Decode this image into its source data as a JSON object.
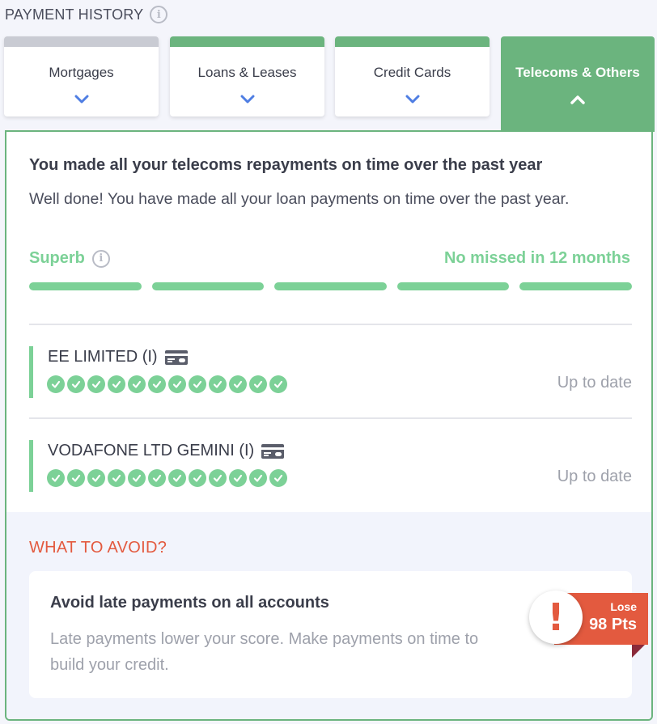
{
  "header": {
    "title": "PAYMENT HISTORY",
    "info_icon": "info-icon"
  },
  "tabs": [
    {
      "label": "Mortgages",
      "bar_color": "#c9cbd3",
      "icon": "chevron-down-icon"
    },
    {
      "label": "Loans & Leases",
      "bar_color": "#6bb47e",
      "icon": "chevron-down-icon"
    },
    {
      "label": "Credit Cards",
      "bar_color": "#6bb47e",
      "icon": "chevron-down-icon"
    },
    {
      "label": "Telecoms & Others",
      "active": true,
      "icon": "chevron-up-icon"
    }
  ],
  "summary": {
    "headline": "You made all your telecoms repayments on time over the past year",
    "subtext": "Well done! You have made all your loan payments on time over the past year.",
    "rating": "Superb",
    "missed": "No missed in 12 months",
    "segments": 5
  },
  "accounts": [
    {
      "name": "EE LIMITED (I)",
      "icon": "card-icon",
      "status": "Up to date",
      "months_on_time": 12
    },
    {
      "name": "VODAFONE LTD GEMINI (I)",
      "icon": "card-icon",
      "status": "Up to date",
      "months_on_time": 12
    }
  ],
  "avoid": {
    "title": "WHAT TO AVOID?",
    "headline": "Avoid late payments on all accounts",
    "body": "Late payments lower your score. Make payments on time to build your credit.",
    "badge_top": "Lose",
    "badge_points": "98 Pts",
    "icon": "exclamation-icon"
  },
  "colors": {
    "accent_green": "#6bb47e",
    "light_green": "#7cd197",
    "warning_red": "#e35a3f"
  }
}
